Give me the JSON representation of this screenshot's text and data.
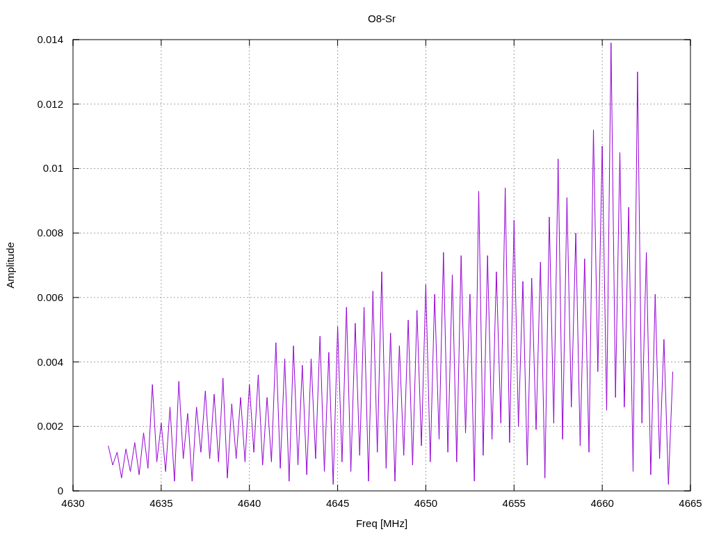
{
  "chart": {
    "chart_data": {
      "type": "line",
      "title": "O8-Sr",
      "xlabel": "Freq [MHz]",
      "ylabel": "Amplitude",
      "xlim": [
        4630,
        4665
      ],
      "grid": true,
      "ylim": [
        0,
        0.014
      ],
      "xticks": [
        4630,
        4635,
        4640,
        4645,
        4650,
        4655,
        4660,
        4665
      ],
      "yticks": [
        {
          "value": 0,
          "label": "0"
        },
        {
          "value": 0.002,
          "label": "0.002"
        },
        {
          "value": 0.004,
          "label": "0.004"
        },
        {
          "value": 0.006,
          "label": "0.006"
        },
        {
          "value": 0.008,
          "label": "0.008"
        },
        {
          "value": 0.01,
          "label": "0.01"
        },
        {
          "value": 0.012,
          "label": "0.012"
        },
        {
          "value": 0.014,
          "label": "0.014"
        }
      ],
      "x": [
        4632,
        4632.25,
        4632.5,
        4632.75,
        4633,
        4633.25,
        4633.5,
        4633.75,
        4634,
        4634.25,
        4634.5,
        4634.75,
        4635,
        4635.25,
        4635.5,
        4635.75,
        4636,
        4636.25,
        4636.5,
        4636.75,
        4637,
        4637.25,
        4637.5,
        4637.75,
        4638,
        4638.25,
        4638.5,
        4638.75,
        4639,
        4639.25,
        4639.5,
        4639.75,
        4640,
        4640.25,
        4640.5,
        4640.75,
        4641,
        4641.25,
        4641.5,
        4641.75,
        4642,
        4642.25,
        4642.5,
        4642.75,
        4643,
        4643.25,
        4643.5,
        4643.75,
        4644,
        4644.25,
        4644.5,
        4644.75,
        4645,
        4645.25,
        4645.5,
        4645.75,
        4646,
        4646.25,
        4646.5,
        4646.75,
        4647,
        4647.25,
        4647.5,
        4647.75,
        4648,
        4648.25,
        4648.5,
        4648.75,
        4649,
        4649.25,
        4649.5,
        4649.75,
        4650,
        4650.25,
        4650.5,
        4650.75,
        4651,
        4651.25,
        4651.5,
        4651.75,
        4652,
        4652.25,
        4652.5,
        4652.75,
        4653,
        4653.25,
        4653.5,
        4653.75,
        4654,
        4654.25,
        4654.5,
        4654.75,
        4655,
        4655.25,
        4655.5,
        4655.75,
        4656,
        4656.25,
        4656.5,
        4656.75,
        4657,
        4657.25,
        4657.5,
        4657.75,
        4658,
        4658.25,
        4658.5,
        4658.75,
        4659,
        4659.25,
        4659.5,
        4659.75,
        4660,
        4660.25,
        4660.5,
        4660.75,
        4661,
        4661.25,
        4661.5,
        4661.75,
        4662,
        4662.25,
        4662.5,
        4662.75,
        4663,
        4663.25,
        4663.5,
        4663.75,
        4664
      ],
      "series": [
        {
          "color": "#9400d3",
          "values": [
            0.0014,
            0.0008,
            0.0012,
            0.0004,
            0.0013,
            0.0006,
            0.0015,
            0.0005,
            0.0018,
            0.0007,
            0.0033,
            0.0009,
            0.0021,
            0.0006,
            0.0026,
            0.0003,
            0.0034,
            0.001,
            0.0024,
            0.0003,
            0.0026,
            0.0012,
            0.0031,
            0.001,
            0.003,
            0.0009,
            0.0035,
            0.0004,
            0.0027,
            0.001,
            0.0029,
            0.0009,
            0.0033,
            0.0012,
            0.0036,
            0.0008,
            0.0029,
            0.0009,
            0.0046,
            0.0007,
            0.0041,
            0.0003,
            0.0045,
            0.0008,
            0.0039,
            0.0005,
            0.0041,
            0.001,
            0.0048,
            0.0006,
            0.0043,
            0.0002,
            0.0051,
            0.0009,
            0.0057,
            0.0006,
            0.0052,
            0.0011,
            0.0057,
            0.0003,
            0.0062,
            0.0012,
            0.0068,
            0.0007,
            0.0049,
            0.0003,
            0.0045,
            0.0011,
            0.0053,
            0.0008,
            0.0056,
            0.0014,
            0.0064,
            0.0009,
            0.0061,
            0.0016,
            0.0074,
            0.0012,
            0.0067,
            0.0009,
            0.0073,
            0.0018,
            0.0061,
            0.0003,
            0.0093,
            0.0011,
            0.0073,
            0.0016,
            0.0068,
            0.0021,
            0.0094,
            0.0015,
            0.0084,
            0.002,
            0.0065,
            0.0008,
            0.0066,
            0.0019,
            0.0071,
            0.0004,
            0.0085,
            0.0021,
            0.0103,
            0.0016,
            0.0091,
            0.0026,
            0.008,
            0.0014,
            0.0072,
            0.0012,
            0.0112,
            0.0037,
            0.0107,
            0.0025,
            0.0139,
            0.0029,
            0.0105,
            0.0026,
            0.0088,
            0.0006,
            0.013,
            0.0021,
            0.0074,
            0.0005,
            0.0061,
            0.001,
            0.0047,
            0.0002,
            0.0037
          ]
        }
      ]
    }
  }
}
